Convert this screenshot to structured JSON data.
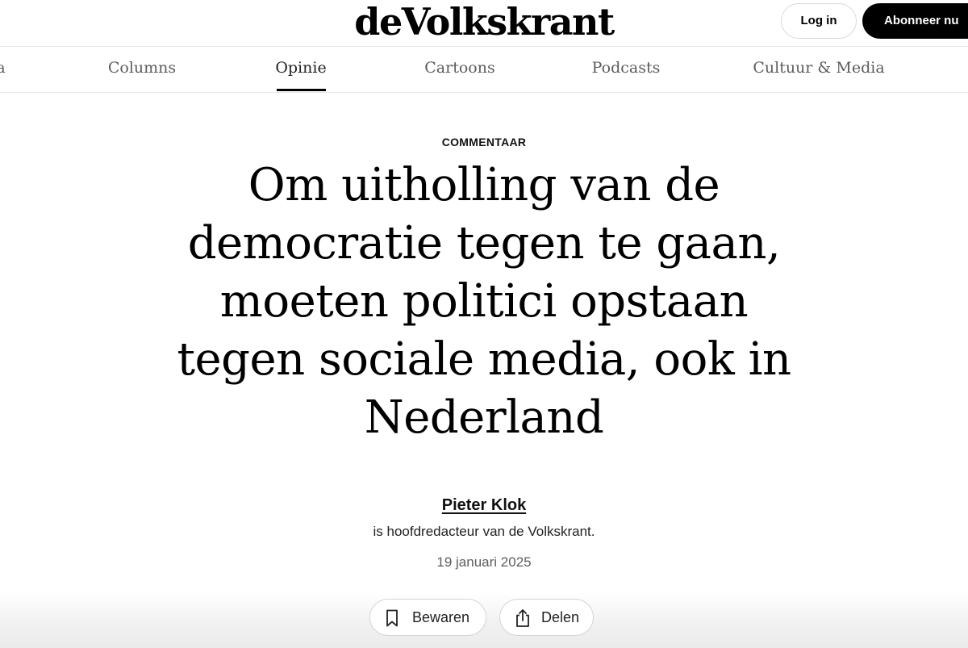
{
  "header": {
    "logo_text": "deVolkskrant",
    "login_label": "Log in",
    "subscribe_label": "Abonneer nu"
  },
  "nav": {
    "items": [
      {
        "label": "a"
      },
      {
        "label": "Columns"
      },
      {
        "label": "Opinie",
        "active": true
      },
      {
        "label": "Cartoons"
      },
      {
        "label": "Podcasts"
      },
      {
        "label": "Cultuur & Media"
      }
    ]
  },
  "article": {
    "category": "COMMENTAAR",
    "headline_lines": [
      "Om uitholling van de",
      "democratie tegen te gaan,",
      "moeten politici opstaan",
      "tegen sociale media, ook in",
      "Nederland"
    ],
    "author": "Pieter Klok",
    "author_description": "is hoofdredacteur van de Volkskrant.",
    "date": "19 januari 2025"
  },
  "actions": {
    "save_label": "Bewaren",
    "save_icon": "bookmark-icon",
    "share_label": "Delen",
    "share_icon": "share-icon"
  }
}
